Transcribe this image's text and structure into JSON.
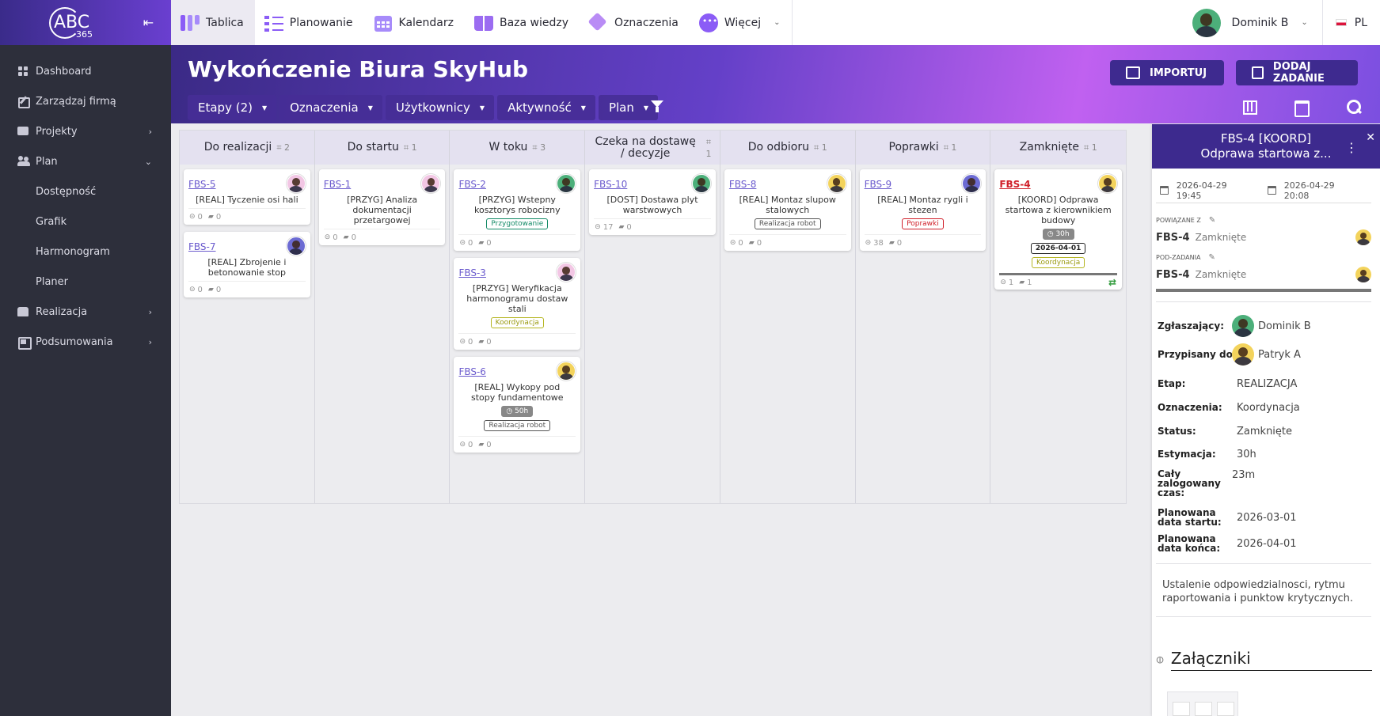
{
  "app": {
    "logo_text": "ABC",
    "logo_sub": "365",
    "collapse_icon": "arrow-collapse-icon"
  },
  "sidebar": {
    "items": [
      {
        "label": "Dashboard",
        "icon": "grid-icon"
      },
      {
        "label": "Zarządzaj firmą",
        "icon": "edit-icon"
      },
      {
        "label": "Projekty",
        "icon": "folder-icon",
        "chevron": "›"
      },
      {
        "label": "Plan",
        "icon": "users-icon",
        "chevron": "⌄"
      },
      {
        "label": "Realizacja",
        "icon": "toolbox-icon",
        "chevron": "›"
      },
      {
        "label": "Podsumowania",
        "icon": "summary-icon",
        "chevron": "›"
      }
    ],
    "plan_sub": [
      "Dostępność",
      "Grafik",
      "Harmonogram",
      "Planer"
    ]
  },
  "topnav": {
    "items": [
      "Tablica",
      "Planowanie",
      "Kalendarz",
      "Baza wiedzy",
      "Oznaczenia",
      "Więcej"
    ],
    "user_name": "Dominik B",
    "language": "PL"
  },
  "header": {
    "title": "Wykończenie Biura SkyHub",
    "import_label": "IMPORTUJ",
    "add_task_label": "DODAJ ZADANIE",
    "filters": [
      "Etapy (2)",
      "Oznaczenia",
      "Użytkownicy",
      "Aktywność",
      "Plan"
    ]
  },
  "colors": {
    "accent": "#3d2a8e",
    "sidebar_bg": "#2d2f3b",
    "link": "#6a5acd",
    "danger": "#d0202a"
  },
  "board": {
    "columns": [
      {
        "title": "Do realizacji",
        "count": "2",
        "cards": [
          {
            "id": "FBS-5",
            "title": "[REAL] Tyczenie osi hali",
            "avatar": "pink",
            "links": "0",
            "comments": "0",
            "badges": []
          },
          {
            "id": "FBS-7",
            "title": "[REAL] Zbrojenie i betonowanie stop",
            "avatar": "purple",
            "links": "0",
            "comments": "0",
            "badges": []
          }
        ]
      },
      {
        "title": "Do startu",
        "count": "1",
        "cards": [
          {
            "id": "FBS-1",
            "title": "[PRZYG] Analiza dokumentacji przetargowej",
            "avatar": "pink",
            "links": "0",
            "comments": "0",
            "badges": []
          }
        ]
      },
      {
        "title": "W toku",
        "count": "3",
        "cards": [
          {
            "id": "FBS-2",
            "title": "[PRZYG] Wstepny kosztorys robocizny",
            "avatar": "green",
            "links": "0",
            "comments": "0",
            "badges": [
              {
                "text": "Przygotowanie",
                "style": "green"
              }
            ]
          },
          {
            "id": "FBS-3",
            "title": "[PRZYG] Weryfikacja harmonogramu dostaw stali",
            "avatar": "pink",
            "links": "0",
            "comments": "0",
            "badges": [
              {
                "text": "Koordynacja",
                "style": "olive"
              }
            ]
          },
          {
            "id": "FBS-6",
            "title": "[REAL] Wykopy pod stopy fundamentowe",
            "avatar": "yellow",
            "links": "0",
            "comments": "0",
            "badges": [
              {
                "text": "50h",
                "style": "time"
              },
              {
                "text": "Realizacja robot",
                "style": "gray"
              }
            ]
          }
        ]
      },
      {
        "title": "Czeka na dostawę / decyzje",
        "count": "1",
        "cards": [
          {
            "id": "FBS-10",
            "title": "[DOST] Dostawa plyt warstwowych",
            "avatar": "green",
            "links": "17",
            "comments": "0",
            "badges": []
          }
        ]
      },
      {
        "title": "Do odbioru",
        "count": "1",
        "cards": [
          {
            "id": "FBS-8",
            "title": "[REAL] Montaz slupow stalowych",
            "avatar": "yellow",
            "links": "0",
            "comments": "0",
            "badges": [
              {
                "text": "Realizacja robot",
                "style": "gray"
              }
            ]
          }
        ]
      },
      {
        "title": "Poprawki",
        "count": "1",
        "cards": [
          {
            "id": "FBS-9",
            "title": "[REAL] Montaz rygli i stezen",
            "avatar": "purple",
            "links": "38",
            "comments": "0",
            "badges": [
              {
                "text": "Poprawki",
                "style": "red"
              }
            ]
          }
        ]
      },
      {
        "title": "Zamknięte",
        "count": "1",
        "cards": [
          {
            "id": "FBS-4",
            "title": "[KOORD] Odprawa startowa z kierownikiem budowy",
            "avatar": "yellow",
            "links": "1",
            "comments": "1",
            "selected": true,
            "badges": [
              {
                "text": "30h",
                "style": "time"
              },
              {
                "text": "2026-04-01",
                "style": "date"
              },
              {
                "text": "Koordynacja",
                "style": "olive"
              }
            ]
          }
        ]
      }
    ]
  },
  "panel": {
    "title_line1": "FBS-4 [KOORD]",
    "title_line2": "Odprawa startowa z...",
    "date_start": "2026-04-29 19:45",
    "date_end": "2026-04-29 20:08",
    "related_label": "POWIĄZANE Z",
    "related_id": "FBS-4",
    "related_status": "Zamknięte",
    "subtasks_label": "POD-ZADANIA",
    "subtask_id": "FBS-4",
    "subtask_status": "Zamknięte",
    "fields": {
      "reporter_label": "Zgłaszający:",
      "reporter": "Dominik B",
      "assignee_label": "Przypisany do:",
      "assignee": "Patryk A",
      "stage_label": "Etap:",
      "stage": "REALIZACJA",
      "tags_label": "Oznaczenia:",
      "tags": "Koordynacja",
      "status_label": "Status:",
      "status": "Zamknięte",
      "estimate_label": "Estymacja:",
      "estimate": "30h",
      "logged_label": "Cały zalogowany czas:",
      "logged": "23m",
      "planned_start_label": "Planowana data startu:",
      "planned_start": "2026-03-01",
      "planned_end_label": "Planowana data końca:",
      "planned_end": "2026-04-01"
    },
    "description": "Ustalenie odpowiedzialnosci, rytmu raportowania i punktow krytycznych.",
    "attachments_label": "Załączniki"
  }
}
